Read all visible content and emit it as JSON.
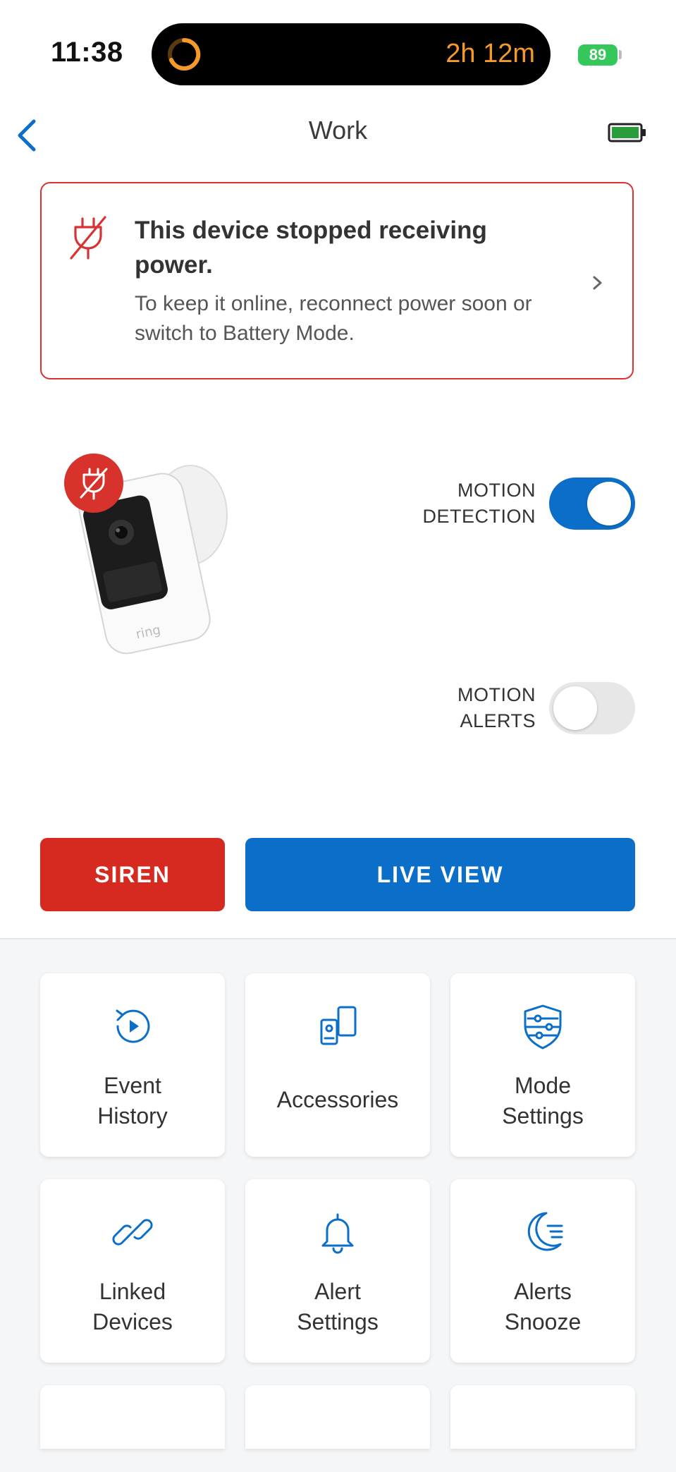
{
  "status_bar": {
    "time": "11:38",
    "timer": "2h 12m",
    "battery": "89"
  },
  "nav": {
    "title": "Work"
  },
  "alert": {
    "title": "This device stopped receiving power.",
    "body": "To keep it online, reconnect power soon or switch to Battery Mode."
  },
  "toggles": {
    "motion_detection": {
      "label_line1": "MOTION",
      "label_line2": "DETECTION",
      "on": true
    },
    "motion_alerts": {
      "label_line1": "MOTION",
      "label_line2": "ALERTS",
      "on": false
    }
  },
  "actions": {
    "siren": "SIREN",
    "live_view": "LIVE VIEW"
  },
  "tiles": [
    {
      "line1": "Event",
      "line2": "History",
      "icon": "history-icon"
    },
    {
      "line1": "Accessories",
      "line2": "",
      "icon": "accessories-icon"
    },
    {
      "line1": "Mode",
      "line2": "Settings",
      "icon": "mode-settings-icon"
    },
    {
      "line1": "Linked",
      "line2": "Devices",
      "icon": "link-icon"
    },
    {
      "line1": "Alert",
      "line2": "Settings",
      "icon": "bell-icon"
    },
    {
      "line1": "Alerts",
      "line2": "Snooze",
      "icon": "snooze-moon-icon"
    }
  ],
  "colors": {
    "accent_blue": "#0b6fc9",
    "alert_red": "#d93232",
    "siren_red": "#d62a20",
    "timer_orange": "#f39a2b"
  }
}
